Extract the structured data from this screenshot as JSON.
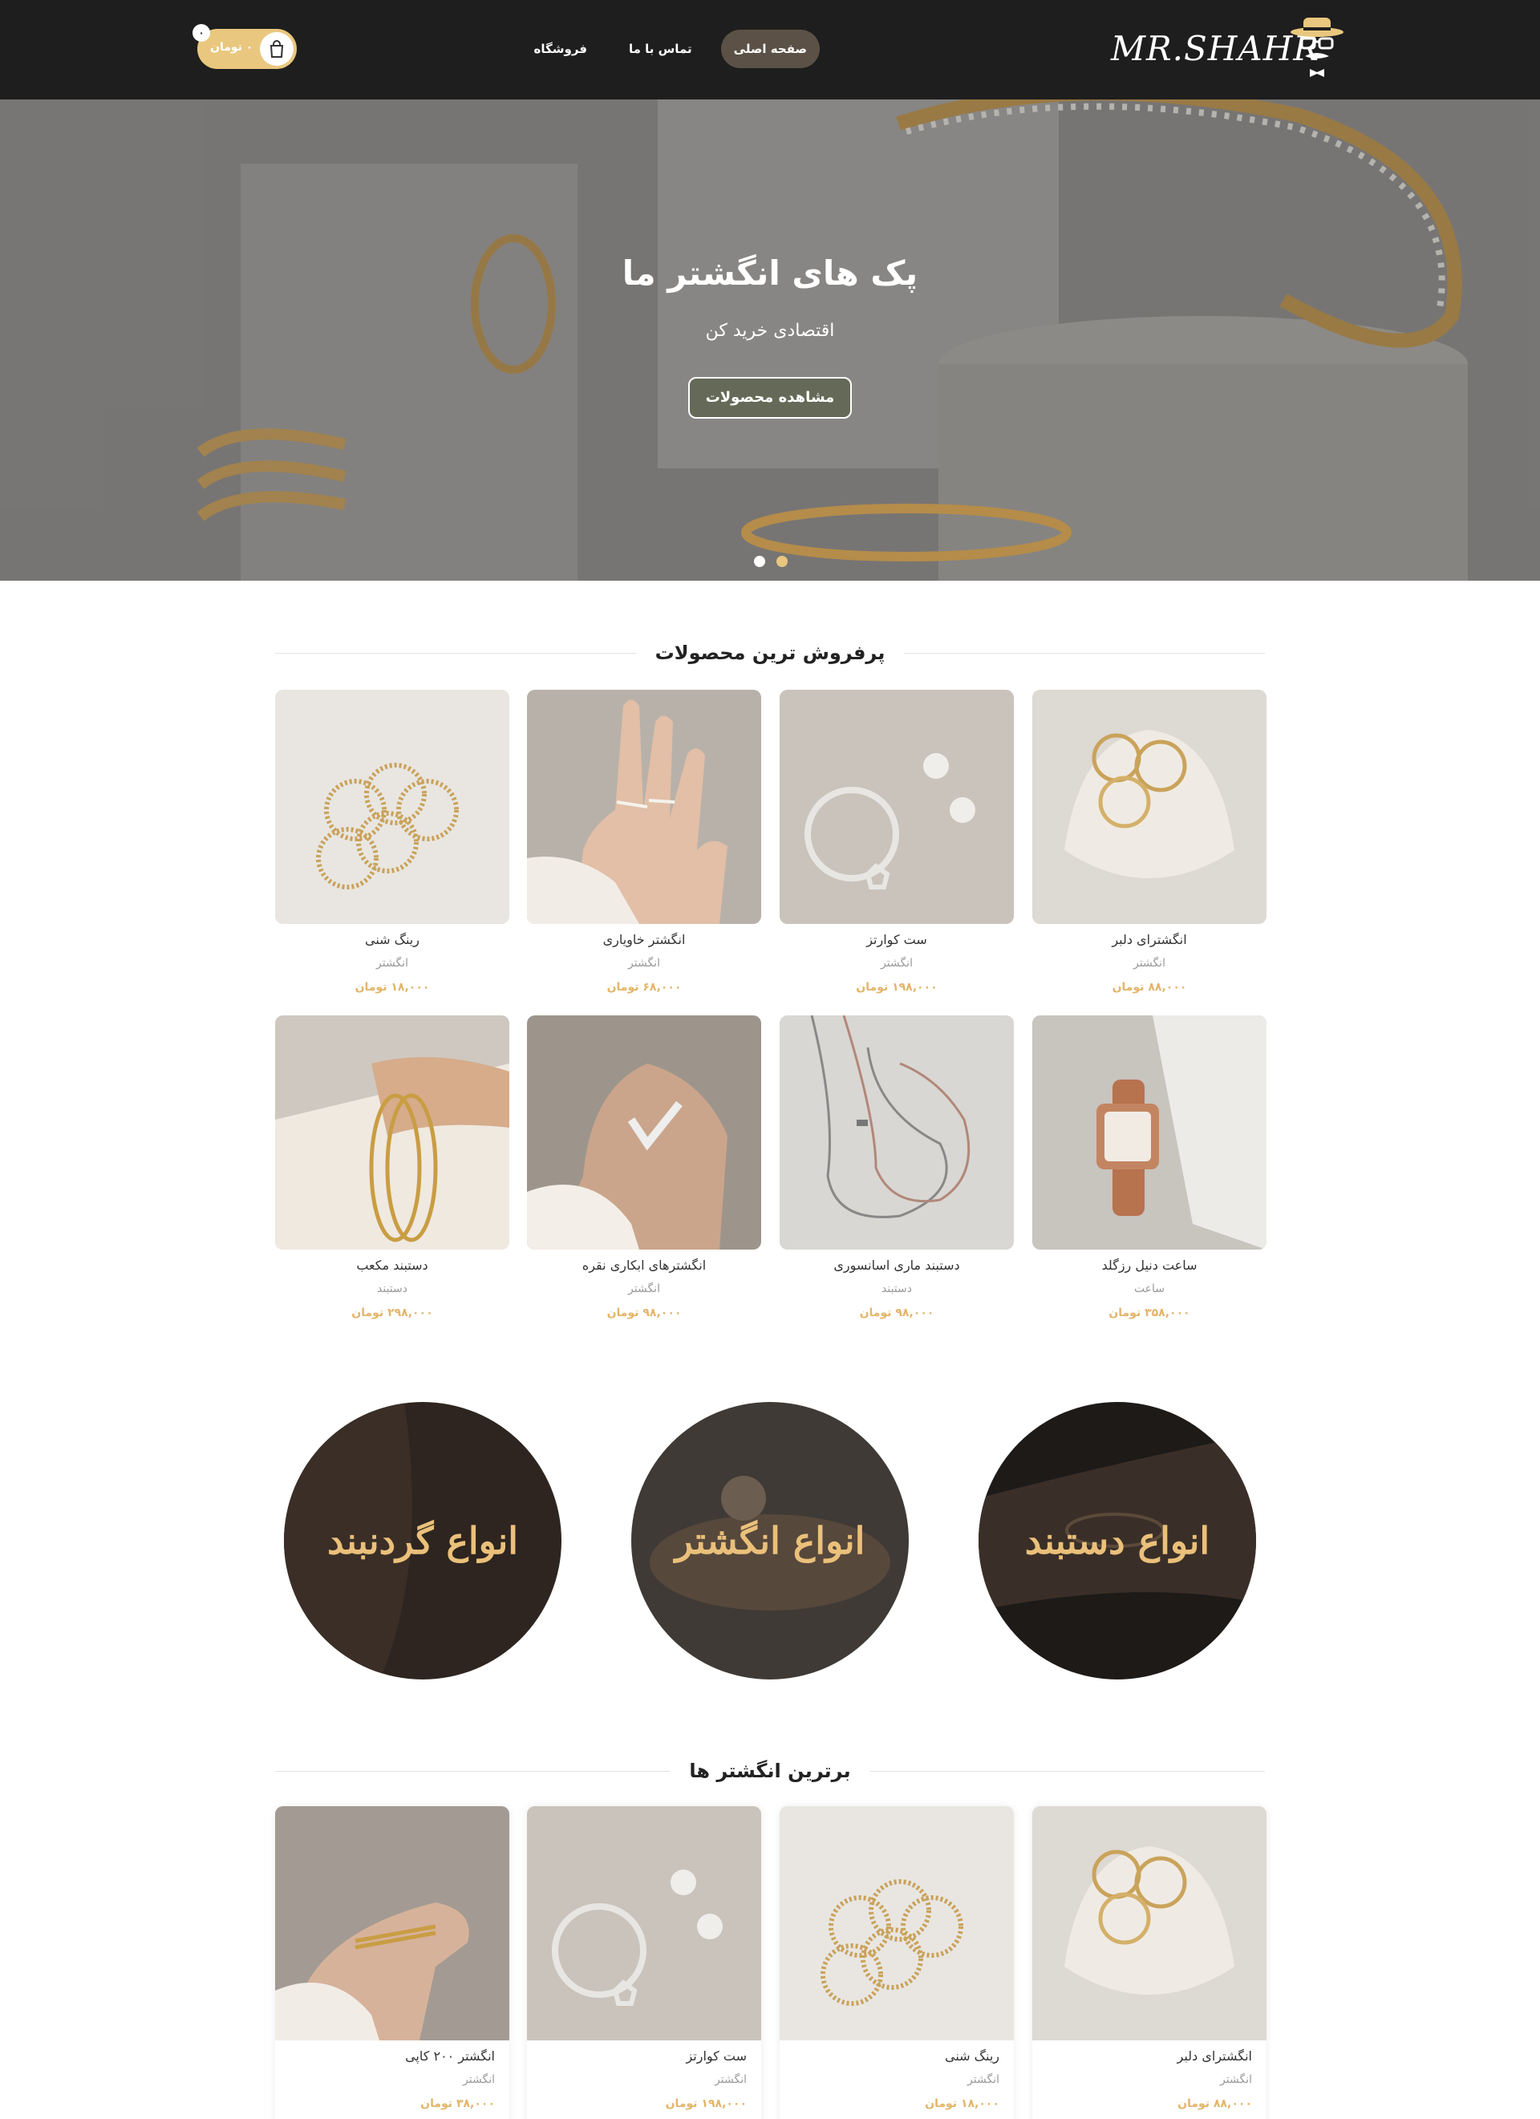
{
  "header": {
    "logo_text": "MR.SHAHR",
    "nav": [
      {
        "label": "صفحه اصلی",
        "active": true
      },
      {
        "label": "تماس با ما",
        "active": false
      },
      {
        "label": "فروشگاه",
        "active": false
      }
    ],
    "cart": {
      "count": "۰",
      "price": "۰ تومان"
    }
  },
  "hero": {
    "title": "پک های انگشتر ما",
    "subtitle": "اقتصادی خرید کن",
    "button": "مشاهده محصولات",
    "slides": 2,
    "active_slide": 2
  },
  "bestsellers": {
    "title": "پرفروش ترین محصولات",
    "products": [
      {
        "name": "انگشترای دلبر",
        "category": "انگشتر",
        "price": "۸۸,۰۰۰ تومان",
        "image": "rings-shell"
      },
      {
        "name": "ست کوارتز",
        "category": "انگشتر",
        "price": "۱۹۸,۰۰۰ تومان",
        "image": "silver-ring-earrings"
      },
      {
        "name": "انگشتر خاویاری",
        "category": "انگشتر",
        "price": "۶۸,۰۰۰ تومان",
        "image": "hand-rings"
      },
      {
        "name": "رینگ شنی",
        "category": "انگشتر",
        "price": "۱۸,۰۰۰ تومان",
        "image": "gold-rings-stack"
      },
      {
        "name": "ساعت دنیل رزگلد",
        "category": "ساعت",
        "price": "۳۵۸,۰۰۰ تومان",
        "image": "rose-gold-watch"
      },
      {
        "name": "دستبند ماری اسانسوری",
        "category": "دستبند",
        "price": "۹۸,۰۰۰ تومان",
        "image": "chain-bracelets"
      },
      {
        "name": "انگشترهای ابکاری نقره",
        "category": "انگشتر",
        "price": "۹۸,۰۰۰ تومان",
        "image": "v-ring-hand"
      },
      {
        "name": "دستبند مکعب",
        "category": "دستبند",
        "price": "۲۹۸,۰۰۰ تومان",
        "image": "cuff-bracelet"
      }
    ]
  },
  "categories": [
    {
      "label": "انواع دستبند"
    },
    {
      "label": "انواع انگشتر"
    },
    {
      "label": "انواع گردنبند"
    }
  ],
  "top_rings": {
    "title": "برترین انگشتر ها",
    "products": [
      {
        "name": "انگشترای دلبر",
        "category": "انگشتر",
        "price": "۸۸,۰۰۰ تومان"
      },
      {
        "name": "رینگ شنی",
        "category": "انگشتر",
        "price": "۱۸,۰۰۰ تومان"
      },
      {
        "name": "ست کوارتز",
        "category": "انگشتر",
        "price": "۱۹۸,۰۰۰ تومان"
      },
      {
        "name": "انگشتر ۲۰۰ کاپی",
        "category": "انگشتر",
        "price": "۳۸,۰۰۰ تومان"
      }
    ]
  },
  "colors": {
    "header_bg": "#1e1e1e",
    "accent_gold": "#e9c77e",
    "price_gold": "#e3b56a",
    "nav_active": "#5b5146",
    "hero_button": "#646a57"
  }
}
